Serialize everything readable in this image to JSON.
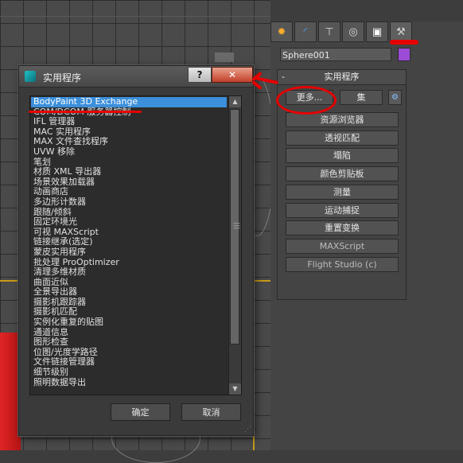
{
  "dialog": {
    "title": "实用程序",
    "help_label": "?",
    "close_label": "✕",
    "ok_label": "确定",
    "cancel_label": "取消",
    "items": [
      {
        "label": "BodyPaint 3D Exchange",
        "selected": true
      },
      {
        "label": "COM/DCOM 服务器控制"
      },
      {
        "label": "IFL 管理器"
      },
      {
        "label": "MAC 实用程序"
      },
      {
        "label": "MAX 文件查找程序"
      },
      {
        "label": "UVW 移除"
      },
      {
        "label": "笔划"
      },
      {
        "label": "材质 XML 导出器"
      },
      {
        "label": "场景效果加载器"
      },
      {
        "label": "动画商店"
      },
      {
        "label": "多边形计数器"
      },
      {
        "label": "跟随/倾斜"
      },
      {
        "label": "固定环境光"
      },
      {
        "label": "可视 MAXScript"
      },
      {
        "label": "链接继承(选定)"
      },
      {
        "label": "蒙皮实用程序"
      },
      {
        "label": "批处理 ProOptimizer"
      },
      {
        "label": "清理多维材质"
      },
      {
        "label": "曲面近似"
      },
      {
        "label": "全景导出器"
      },
      {
        "label": "摄影机跟踪器"
      },
      {
        "label": "摄影机匹配"
      },
      {
        "label": "实例化重复的贴图"
      },
      {
        "label": "通道信息"
      },
      {
        "label": "图形检查"
      },
      {
        "label": "位图/光度学路径"
      },
      {
        "label": "文件链接管理器"
      },
      {
        "label": "细节级别"
      },
      {
        "label": "照明数据导出"
      }
    ]
  },
  "command_panel": {
    "tabs": [
      {
        "icon": "sun-icon",
        "glyph": "✹"
      },
      {
        "icon": "arc-icon",
        "glyph": "◜"
      },
      {
        "icon": "hierarchy-icon",
        "glyph": "⊤"
      },
      {
        "icon": "motion-icon",
        "glyph": "◎"
      },
      {
        "icon": "display-icon",
        "glyph": "▣"
      },
      {
        "icon": "hammer-icon",
        "glyph": "⚒"
      }
    ],
    "object_name": "Sphere001",
    "object_color": "#9c4bd6",
    "rollout": {
      "title": "实用程序",
      "collapse_symbol": "-",
      "more_label": "更多...",
      "sets_label": "集",
      "config_glyph": "⚙",
      "buttons": [
        {
          "label": "资源浏览器"
        },
        {
          "label": "透视匹配"
        },
        {
          "label": "塌陷"
        },
        {
          "label": "颜色剪贴板"
        },
        {
          "label": "测量"
        },
        {
          "label": "运动捕捉"
        },
        {
          "label": "重置变换"
        },
        {
          "label": "MAXScript",
          "muted": true
        },
        {
          "label": "Flight Studio (c)",
          "muted": true
        }
      ]
    }
  },
  "colors": {
    "annotation": "#e60000",
    "selection": "#3c8fda",
    "accent_yellow": "#c89c18"
  }
}
